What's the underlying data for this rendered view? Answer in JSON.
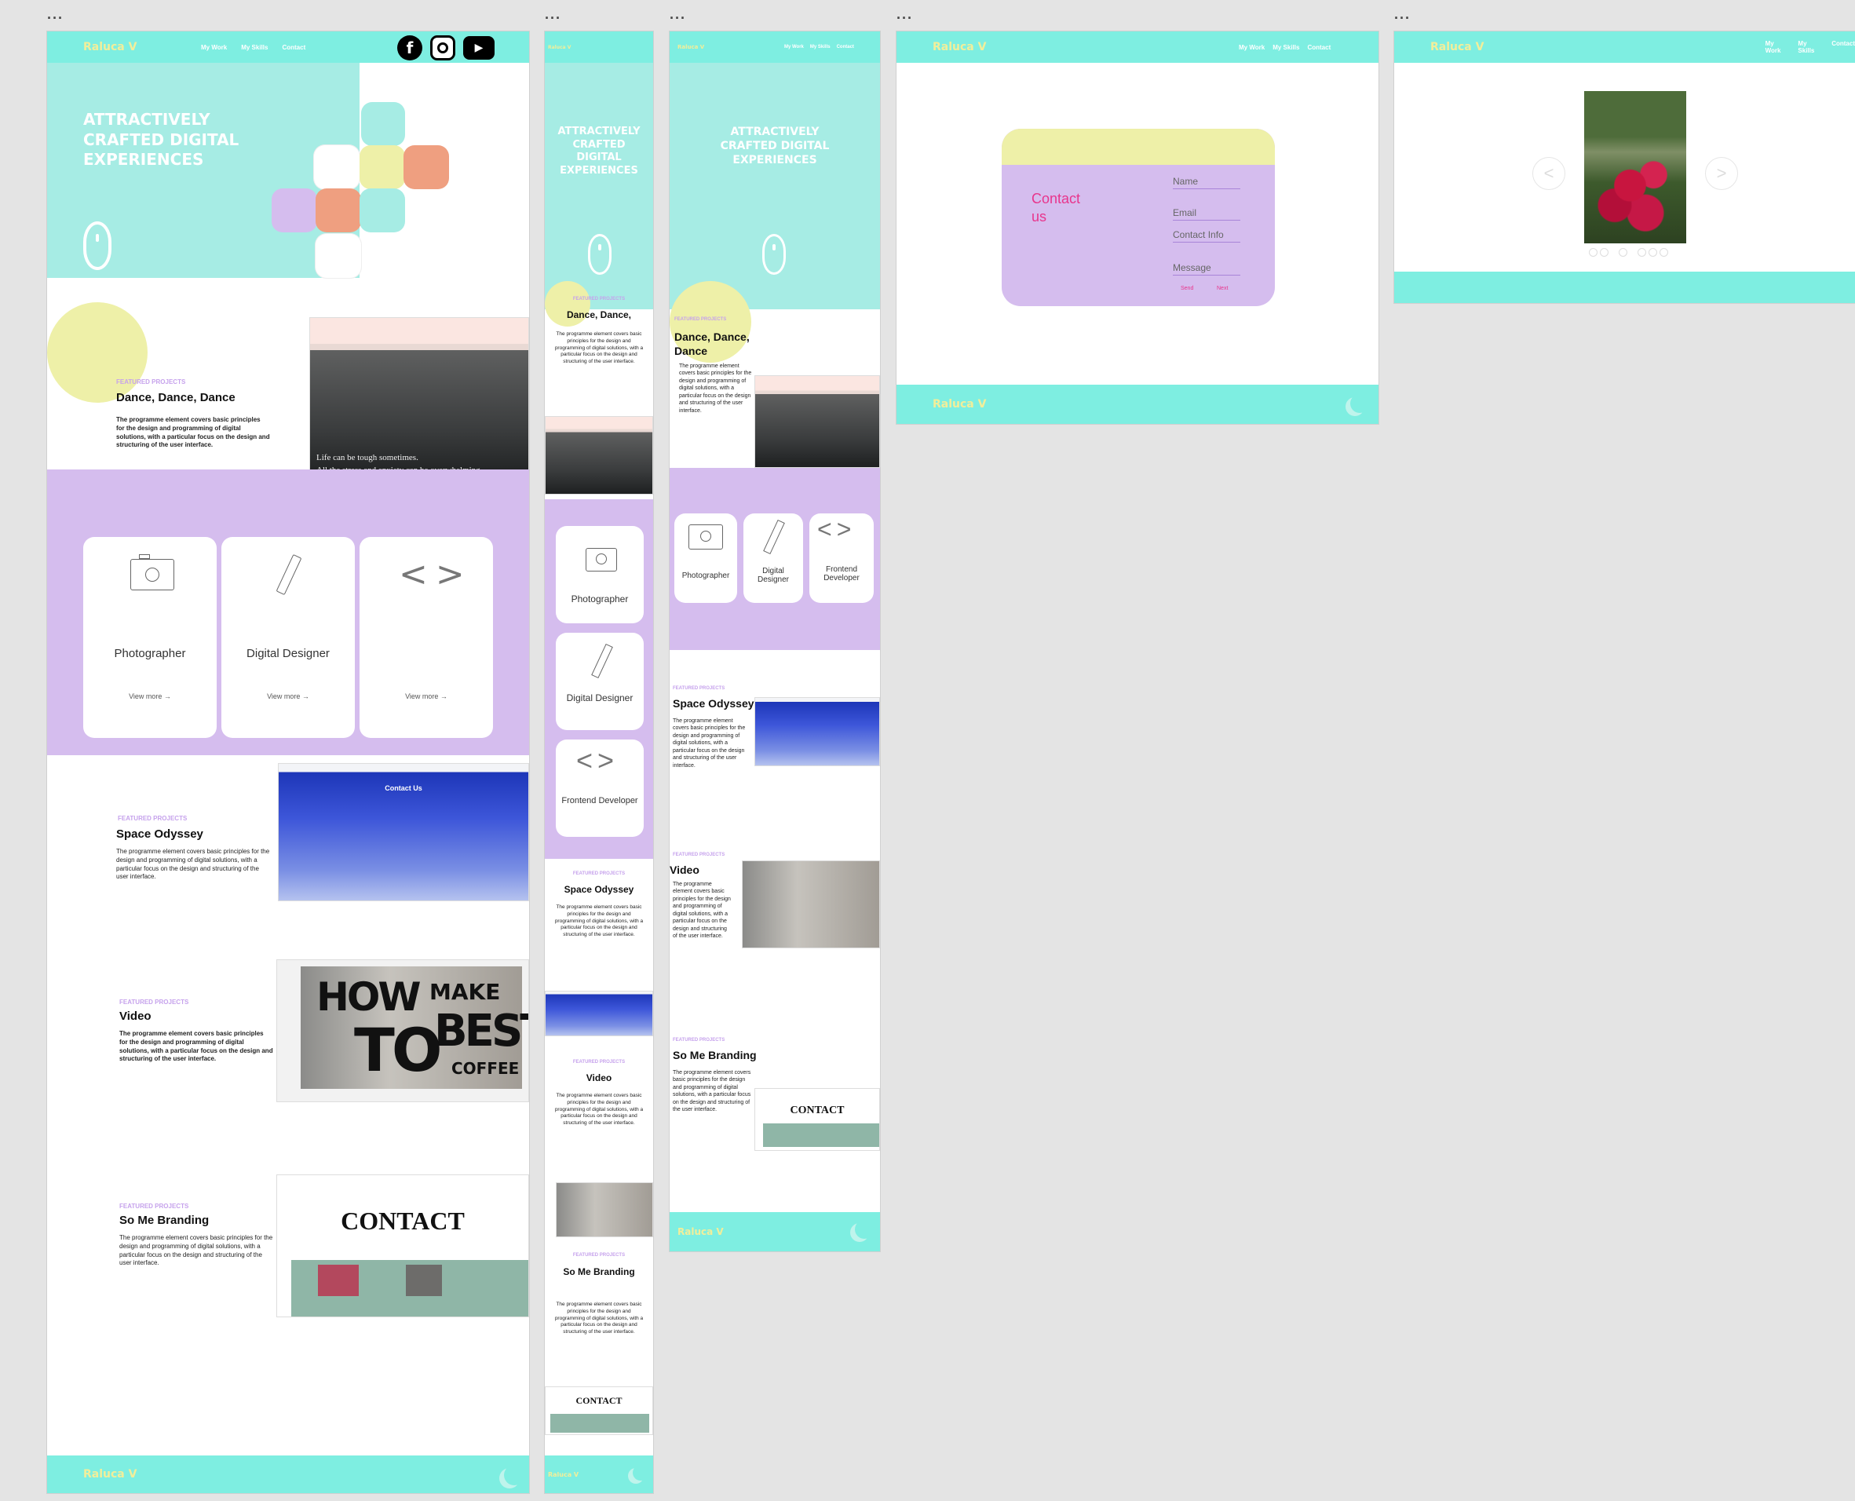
{
  "brand": "Raluca V",
  "nav": [
    "My Work",
    "My Skills",
    "Contact"
  ],
  "hero_title": [
    "ATTRACTIVELY",
    "CRAFTED DIGITAL",
    "EXPERIENCES"
  ],
  "hero_title_tablet": [
    "ATTRACTIVELY",
    "CRAFTED",
    "DIGITAL",
    "EXPERIENCES"
  ],
  "hero_title_mobile": [
    "ATTRACTIVELY",
    "CRAFTED DIGITAL",
    "EXPERIENCES"
  ],
  "social_icons": [
    "facebook-icon",
    "instagram-icon",
    "youtube-icon"
  ],
  "eyebrow": "FEATURED PROJECTS",
  "projects": {
    "dance": "Dance, Dance, Dance",
    "dance_short": "Dance, Dance,",
    "space": "Space Odyssey",
    "video": "Video",
    "branding": "So Me Branding",
    "desc": "The programme element covers basic principles for the design and programming of digital solutions, with a particular focus on the design and structuring of the user interface."
  },
  "skills": [
    {
      "label": "Photographer",
      "icon": "camera-icon"
    },
    {
      "label": "Digital Designer",
      "icon": "pencil-icon"
    },
    {
      "label": "Frontend Developer",
      "icon": "code-icon"
    }
  ],
  "view_more": "View more →",
  "thumb_text": {
    "dance_line1": "Life can be tough sometimes.",
    "dance_line2": "All the stress and anxiety can be overwhelming",
    "space_heading": "Contact Us",
    "video_how": "HOW",
    "video_to": "TO",
    "video_make": "MAKE",
    "video_best": "BEST",
    "video_coffee": "COFFEE",
    "contact_heading": "CONTACT"
  },
  "contact_form": {
    "title": "Contact us",
    "fields": [
      "Name",
      "Email",
      "Contact Info",
      "Message"
    ],
    "buttons": [
      "Send",
      "Next"
    ]
  },
  "carousel": {
    "prev": "<",
    "next": ">",
    "dots": 6
  },
  "colors": {
    "teal": "#7eeee1",
    "hero": "#a6ece4",
    "purple": "#d5bdee",
    "yellow": "#eef0a8",
    "salmon": "#ef9f80",
    "brand_text": "#f2ee9a",
    "accent_pink": "#e8358c"
  }
}
